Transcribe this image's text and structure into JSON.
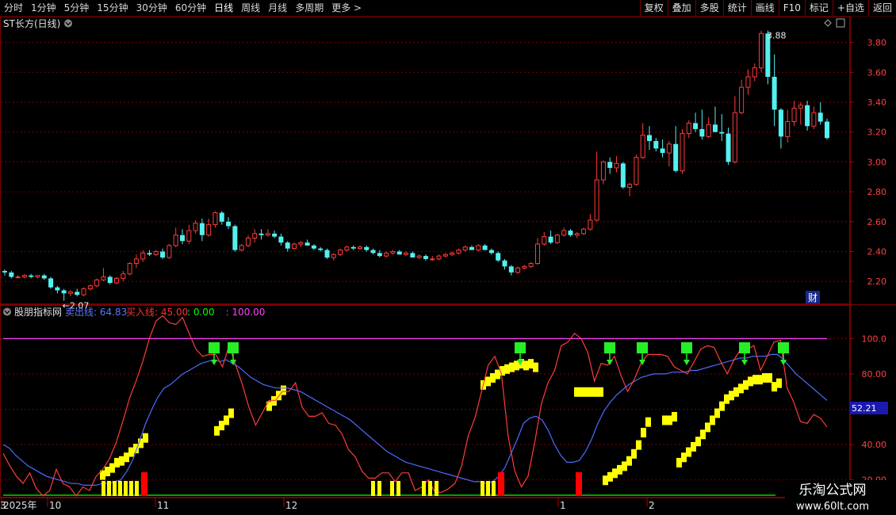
{
  "toolbar": {
    "periods": [
      "分时",
      "1分钟",
      "5分钟",
      "15分钟",
      "30分钟",
      "60分钟",
      "日线",
      "周线",
      "月线",
      "多周期",
      "更多 >"
    ],
    "active_period": "日线",
    "buttons": [
      "复权",
      "叠加",
      "多股",
      "统计",
      "画线",
      "F10",
      "标记",
      "+自选",
      "返回"
    ]
  },
  "main_panel": {
    "title": "ST长方(日线)",
    "high_label": "3.88",
    "low_label": "2.07",
    "cai_label": "财",
    "y_ticks": [
      "3.80",
      "3.60",
      "3.40",
      "3.20",
      "3.00",
      "2.80",
      "2.60",
      "2.40",
      "2.20"
    ]
  },
  "indicator_panel": {
    "name": "股朋指标网",
    "legend": [
      {
        "text": "卖出线: 64.83",
        "color": "#5a78ff"
      },
      {
        "text": "买入线: 45.00",
        "color": "#ff3030"
      },
      {
        "text": ": 0.00",
        "color": "#00ff00"
      },
      {
        "text": ": 100.00",
        "color": "#ff40ff"
      }
    ],
    "y_ticks": [
      "100.0",
      "80.00",
      "60.00",
      "40.00",
      "20.00"
    ],
    "current_value": "52.21"
  },
  "x_axis": {
    "labels": [
      "2025年",
      "10",
      "11",
      "12",
      "1",
      "2",
      "3"
    ]
  },
  "watermark": {
    "title": "乐淘公式网",
    "url": "www.60lt.com"
  },
  "colors": {
    "up": "#ff3b3b",
    "down": "#54f0f0",
    "yellow": "#ffff00",
    "green_arrow": "#26ef26",
    "red_bar": "#ff0000",
    "blue_line": "#4d6cff",
    "magenta": "#ff40ff",
    "grid_red": "#7a0000"
  },
  "chart_data": [
    {
      "type": "candlestick",
      "title": "ST长方(日线)",
      "ylim": [
        2.1,
        3.92
      ],
      "y_ticks": [
        2.2,
        2.4,
        2.6,
        2.8,
        3.0,
        3.2,
        3.4,
        3.6,
        3.8
      ],
      "candles": [
        [
          2.27,
          2.28,
          2.24,
          2.26
        ],
        [
          2.26,
          2.27,
          2.22,
          2.23
        ],
        [
          2.23,
          2.24,
          2.22,
          2.23
        ],
        [
          2.23,
          2.25,
          2.22,
          2.24
        ],
        [
          2.24,
          2.25,
          2.22,
          2.23
        ],
        [
          2.23,
          2.24,
          2.22,
          2.24
        ],
        [
          2.24,
          2.25,
          2.21,
          2.22
        ],
        [
          2.22,
          2.23,
          2.15,
          2.16
        ],
        [
          2.16,
          2.17,
          2.12,
          2.14
        ],
        [
          2.14,
          2.15,
          2.07,
          2.12
        ],
        [
          2.12,
          2.14,
          2.1,
          2.13
        ],
        [
          2.13,
          2.15,
          2.1,
          2.11
        ],
        [
          2.11,
          2.16,
          2.1,
          2.15
        ],
        [
          2.15,
          2.18,
          2.14,
          2.17
        ],
        [
          2.17,
          2.22,
          2.16,
          2.21
        ],
        [
          2.21,
          2.29,
          2.2,
          2.23
        ],
        [
          2.23,
          2.24,
          2.18,
          2.19
        ],
        [
          2.19,
          2.23,
          2.18,
          2.22
        ],
        [
          2.22,
          2.27,
          2.2,
          2.25
        ],
        [
          2.25,
          2.33,
          2.24,
          2.32
        ],
        [
          2.32,
          2.38,
          2.29,
          2.35
        ],
        [
          2.35,
          2.41,
          2.33,
          2.39
        ],
        [
          2.39,
          2.41,
          2.37,
          2.38
        ],
        [
          2.38,
          2.41,
          2.37,
          2.4
        ],
        [
          2.4,
          2.42,
          2.35,
          2.36
        ],
        [
          2.36,
          2.45,
          2.35,
          2.44
        ],
        [
          2.44,
          2.56,
          2.43,
          2.51
        ],
        [
          2.51,
          2.55,
          2.45,
          2.47
        ],
        [
          2.47,
          2.58,
          2.45,
          2.54
        ],
        [
          2.54,
          2.61,
          2.52,
          2.59
        ],
        [
          2.59,
          2.62,
          2.47,
          2.51
        ],
        [
          2.51,
          2.62,
          2.5,
          2.58
        ],
        [
          2.58,
          2.67,
          2.56,
          2.66
        ],
        [
          2.66,
          2.67,
          2.58,
          2.6
        ],
        [
          2.6,
          2.63,
          2.55,
          2.57
        ],
        [
          2.57,
          2.58,
          2.4,
          2.41
        ],
        [
          2.41,
          2.45,
          2.4,
          2.44
        ],
        [
          2.44,
          2.51,
          2.43,
          2.49
        ],
        [
          2.49,
          2.55,
          2.46,
          2.52
        ],
        [
          2.52,
          2.55,
          2.48,
          2.51
        ],
        [
          2.51,
          2.55,
          2.5,
          2.52
        ],
        [
          2.52,
          2.54,
          2.49,
          2.5
        ],
        [
          2.5,
          2.52,
          2.44,
          2.46
        ],
        [
          2.46,
          2.47,
          2.4,
          2.42
        ],
        [
          2.42,
          2.46,
          2.41,
          2.45
        ],
        [
          2.45,
          2.47,
          2.43,
          2.46
        ],
        [
          2.46,
          2.48,
          2.44,
          2.44
        ],
        [
          2.44,
          2.45,
          2.41,
          2.42
        ],
        [
          2.42,
          2.43,
          2.4,
          2.41
        ],
        [
          2.41,
          2.42,
          2.35,
          2.36
        ],
        [
          2.36,
          2.39,
          2.34,
          2.38
        ],
        [
          2.38,
          2.42,
          2.37,
          2.41
        ],
        [
          2.41,
          2.44,
          2.4,
          2.43
        ],
        [
          2.43,
          2.44,
          2.41,
          2.42
        ],
        [
          2.42,
          2.44,
          2.41,
          2.43
        ],
        [
          2.43,
          2.44,
          2.4,
          2.41
        ],
        [
          2.41,
          2.42,
          2.38,
          2.39
        ],
        [
          2.39,
          2.41,
          2.36,
          2.37
        ],
        [
          2.37,
          2.4,
          2.36,
          2.39
        ],
        [
          2.39,
          2.41,
          2.38,
          2.4
        ],
        [
          2.4,
          2.41,
          2.38,
          2.38
        ],
        [
          2.38,
          2.4,
          2.37,
          2.39
        ],
        [
          2.39,
          2.4,
          2.36,
          2.36
        ],
        [
          2.36,
          2.38,
          2.35,
          2.37
        ],
        [
          2.37,
          2.38,
          2.34,
          2.35
        ],
        [
          2.35,
          2.37,
          2.34,
          2.35
        ],
        [
          2.35,
          2.38,
          2.34,
          2.37
        ],
        [
          2.37,
          2.39,
          2.36,
          2.38
        ],
        [
          2.38,
          2.4,
          2.37,
          2.39
        ],
        [
          2.39,
          2.42,
          2.38,
          2.41
        ],
        [
          2.41,
          2.44,
          2.4,
          2.43
        ],
        [
          2.43,
          2.44,
          2.41,
          2.41
        ],
        [
          2.41,
          2.45,
          2.4,
          2.44
        ],
        [
          2.44,
          2.45,
          2.41,
          2.41
        ],
        [
          2.41,
          2.42,
          2.38,
          2.39
        ],
        [
          2.39,
          2.4,
          2.33,
          2.34
        ],
        [
          2.34,
          2.35,
          2.28,
          2.3
        ],
        [
          2.3,
          2.31,
          2.24,
          2.26
        ],
        [
          2.26,
          2.3,
          2.25,
          2.29
        ],
        [
          2.29,
          2.31,
          2.28,
          2.3
        ],
        [
          2.3,
          2.33,
          2.29,
          2.32
        ],
        [
          2.32,
          2.49,
          2.31,
          2.45
        ],
        [
          2.45,
          2.53,
          2.44,
          2.5
        ],
        [
          2.5,
          2.54,
          2.45,
          2.46
        ],
        [
          2.46,
          2.52,
          2.45,
          2.51
        ],
        [
          2.51,
          2.56,
          2.5,
          2.54
        ],
        [
          2.54,
          2.55,
          2.5,
          2.51
        ],
        [
          2.51,
          2.53,
          2.49,
          2.52
        ],
        [
          2.52,
          2.56,
          2.51,
          2.55
        ],
        [
          2.55,
          2.65,
          2.54,
          2.61
        ],
        [
          2.61,
          3.07,
          2.6,
          2.88
        ],
        [
          2.88,
          3.01,
          2.85,
          3.0
        ],
        [
          3.0,
          3.03,
          2.92,
          2.96
        ],
        [
          2.96,
          3.04,
          2.93,
          2.99
        ],
        [
          2.99,
          3.0,
          2.82,
          2.83
        ],
        [
          2.83,
          2.86,
          2.77,
          2.85
        ],
        [
          2.85,
          3.05,
          2.84,
          3.03
        ],
        [
          3.03,
          3.26,
          3.02,
          3.18
        ],
        [
          3.18,
          3.24,
          3.08,
          3.14
        ],
        [
          3.14,
          3.16,
          3.07,
          3.09
        ],
        [
          3.09,
          3.15,
          3.03,
          3.06
        ],
        [
          3.06,
          3.14,
          2.97,
          3.12
        ],
        [
          3.12,
          3.24,
          2.93,
          2.94
        ],
        [
          2.94,
          3.22,
          2.92,
          3.19
        ],
        [
          3.19,
          3.28,
          3.16,
          3.26
        ],
        [
          3.26,
          3.33,
          3.2,
          3.22
        ],
        [
          3.22,
          3.35,
          3.15,
          3.17
        ],
        [
          3.17,
          3.3,
          3.16,
          3.25
        ],
        [
          3.25,
          3.37,
          3.22,
          3.2
        ],
        [
          3.2,
          3.32,
          3.14,
          3.19
        ],
        [
          3.19,
          3.23,
          2.98,
          3.0
        ],
        [
          3.0,
          3.44,
          2.99,
          3.33
        ],
        [
          3.33,
          3.55,
          3.32,
          3.5
        ],
        [
          3.5,
          3.62,
          3.45,
          3.57
        ],
        [
          3.57,
          3.66,
          3.54,
          3.63
        ],
        [
          3.63,
          3.88,
          3.6,
          3.86
        ],
        [
          3.86,
          3.88,
          3.52,
          3.57
        ],
        [
          3.57,
          3.72,
          3.24,
          3.35
        ],
        [
          3.35,
          3.36,
          3.09,
          3.17
        ],
        [
          3.17,
          3.35,
          3.13,
          3.27
        ],
        [
          3.27,
          3.41,
          3.24,
          3.36
        ],
        [
          3.36,
          3.4,
          3.25,
          3.38
        ],
        [
          3.38,
          3.41,
          3.21,
          3.24
        ],
        [
          3.24,
          3.37,
          3.22,
          3.33
        ],
        [
          3.33,
          3.4,
          3.25,
          3.27
        ],
        [
          3.27,
          3.29,
          3.15,
          3.16
        ]
      ]
    },
    {
      "type": "line",
      "title": "股朋指标网",
      "ylim": [
        10,
        119
      ],
      "y_ticks": [
        20,
        40,
        60,
        80,
        100
      ],
      "series": [
        {
          "name": "卖出线",
          "color": "#4d6cff",
          "values": [
            40,
            38,
            34,
            31,
            28,
            26,
            24,
            22,
            21,
            20,
            19,
            18,
            18,
            17,
            17,
            17,
            18,
            18,
            19,
            20,
            25,
            32,
            42,
            52,
            60,
            67,
            72,
            74,
            77,
            80,
            82,
            84,
            86,
            87,
            88,
            87,
            88,
            86,
            84,
            81,
            78,
            76,
            74,
            73,
            72,
            72,
            72,
            71,
            70,
            68,
            66,
            64,
            62,
            60,
            58,
            56,
            54,
            51,
            48,
            45,
            42,
            39,
            36,
            34,
            32,
            30,
            29,
            28,
            27,
            26,
            25,
            24,
            23,
            22,
            21,
            20,
            19,
            19,
            18,
            19,
            22,
            27,
            35,
            43,
            52,
            55,
            56,
            54,
            48,
            40,
            34,
            30,
            30,
            31,
            36,
            43,
            52,
            59,
            64,
            68,
            71,
            74,
            76,
            78,
            79,
            80,
            80,
            80,
            81,
            81,
            81,
            82,
            82,
            83,
            84,
            85,
            86,
            87,
            88,
            89,
            89,
            90,
            90,
            90,
            91,
            91,
            88,
            84,
            80,
            77,
            74,
            71,
            68,
            65
          ]
        },
        {
          "name": "买入线",
          "color": "#ff2020",
          "values": [
            35,
            28,
            22,
            18,
            24,
            15,
            11,
            14,
            26,
            18,
            16,
            11,
            16,
            14,
            22,
            26,
            32,
            41,
            53,
            66,
            76,
            87,
            100,
            110,
            113,
            109,
            108,
            112,
            103,
            94,
            90,
            91,
            91,
            84,
            96,
            85,
            74,
            61,
            51,
            58,
            65,
            65,
            70,
            70,
            75,
            61,
            56,
            56,
            58,
            52,
            51,
            46,
            37,
            33,
            25,
            21,
            21,
            24,
            24,
            19,
            24,
            24,
            14,
            16,
            20,
            13,
            13,
            15,
            18,
            28,
            45,
            55,
            70,
            85,
            90,
            80,
            45,
            25,
            16,
            22,
            41,
            63,
            75,
            82,
            96,
            98,
            103,
            100,
            92,
            76,
            86,
            85,
            90,
            79,
            70,
            77,
            86,
            91,
            91,
            91,
            90,
            84,
            82,
            80,
            87,
            94,
            96,
            95,
            87,
            80,
            88,
            94,
            94,
            96,
            82,
            90,
            98,
            99,
            72,
            64,
            53,
            52,
            57,
            55,
            50
          ]
        },
        {
          "name": "黄色阶梯",
          "color": "#ffff00",
          "values": [
            25,
            27,
            29,
            32,
            33,
            35,
            38,
            40,
            43,
            46,
            50,
            53,
            56,
            60,
            64,
            67,
            70,
            73,
            76,
            78,
            80,
            82,
            84,
            85,
            86,
            87,
            88,
            87,
            88,
            86,
            72,
            72,
            72,
            72,
            72,
            72,
            22,
            24,
            26,
            28,
            30,
            33,
            37,
            42,
            49,
            55,
            56,
            56,
            58,
            32,
            35,
            38,
            41,
            44,
            48,
            52,
            56,
            60,
            64,
            68,
            70,
            72,
            74,
            76,
            78,
            79,
            79,
            80,
            80,
            75,
            77,
            79,
            81,
            83,
            83,
            84,
            84,
            85,
            85,
            86,
            86,
            87,
            87,
            88,
            88,
            89,
            89,
            90,
            90,
            91,
            91,
            92,
            92,
            93,
            93,
            94,
            94,
            94,
            94,
            95,
            95,
            96,
            96,
            97,
            97
          ]
        }
      ]
    }
  ]
}
